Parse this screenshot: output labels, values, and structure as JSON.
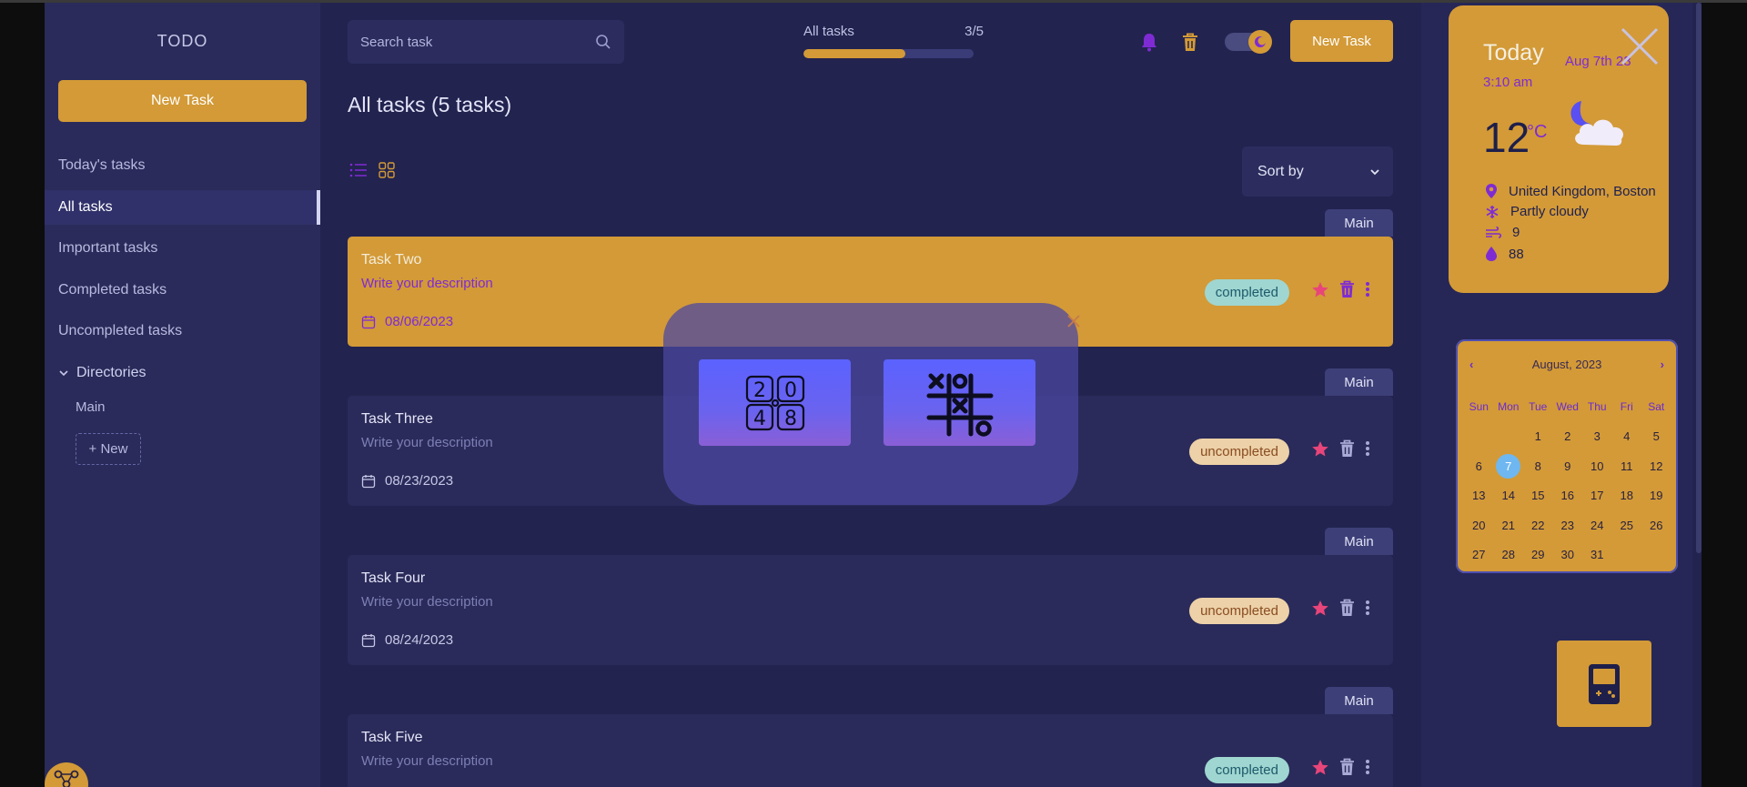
{
  "sidebar": {
    "logo": "TODO",
    "new_task_label": "New Task",
    "nav": [
      {
        "label": "Today's tasks",
        "active": false
      },
      {
        "label": "All tasks",
        "active": true
      },
      {
        "label": "Important tasks",
        "active": false
      },
      {
        "label": "Completed tasks",
        "active": false
      },
      {
        "label": "Uncompleted tasks",
        "active": false
      }
    ],
    "directories_label": "Directories",
    "directories": [
      "Main"
    ],
    "new_dir_label": "+ New"
  },
  "header": {
    "search_placeholder": "Search task",
    "progress_label": "All tasks",
    "progress_count": "3/5",
    "progress_fraction": 0.6,
    "new_task_label": "New Task"
  },
  "main": {
    "title": "All tasks (5 tasks)",
    "sort_label": "Sort by"
  },
  "tasks": [
    {
      "dir": "Main",
      "title": "Task Two",
      "desc": "Write your description",
      "date": "08/06/2023",
      "status": "completed",
      "highlight": true
    },
    {
      "dir": "Main",
      "title": "Task Three",
      "desc": "Write your description",
      "date": "08/23/2023",
      "status": "uncompleted",
      "highlight": false
    },
    {
      "dir": "Main",
      "title": "Task Four",
      "desc": "Write your description",
      "date": "08/24/2023",
      "status": "uncompleted",
      "highlight": false
    },
    {
      "dir": "Main",
      "title": "Task Five",
      "desc": "Write your description",
      "date": "",
      "status": "completed",
      "highlight": false
    }
  ],
  "games_popup": {
    "games": [
      "2048-icon",
      "tic-tac-toe-icon"
    ]
  },
  "weather": {
    "today": "Today",
    "date": "Aug 7th 23",
    "time": "3:10 am",
    "temp": "12",
    "unit": "°C",
    "location": "United Kingdom, Boston",
    "condition": "Partly cloudy",
    "wind": "9",
    "humidity": "88"
  },
  "calendar": {
    "month": "August, 2023",
    "days_of_week": [
      "Sun",
      "Mon",
      "Tue",
      "Wed",
      "Thu",
      "Fri",
      "Sat"
    ],
    "first_weekday": 2,
    "days_in_month": 31,
    "today": 7
  },
  "colors": {
    "accent": "#d39a37",
    "purple": "#7f2bd3",
    "background": "#22234f",
    "sidebar": "#2a2b5a",
    "star": "#e8457a"
  }
}
